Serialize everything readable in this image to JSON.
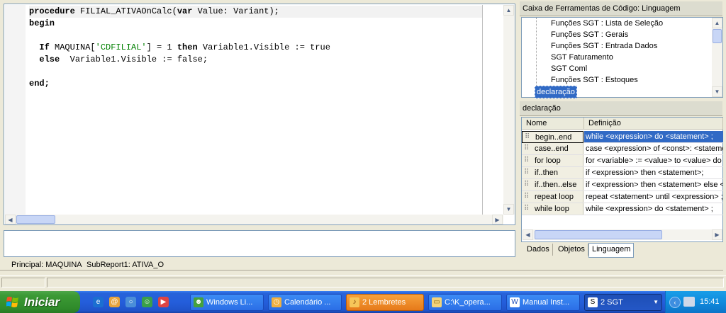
{
  "editor": {
    "lines": [
      {
        "tokens": [
          {
            "t": "procedure",
            "k": "kw"
          },
          {
            "t": " FILIAL_ATIVAOnCalc("
          },
          {
            "t": "var",
            "k": "kw"
          },
          {
            "t": " Value: Variant);"
          }
        ]
      },
      {
        "tokens": [
          {
            "t": "begin",
            "k": "kw"
          }
        ]
      },
      {
        "tokens": []
      },
      {
        "tokens": [
          {
            "t": "  "
          },
          {
            "t": "If",
            "k": "kw"
          },
          {
            "t": " MAQUINA["
          },
          {
            "t": "'CDFILIAL'",
            "k": "str"
          },
          {
            "t": "] = 1 "
          },
          {
            "t": "then",
            "k": "kw"
          },
          {
            "t": " Variable1.Visible := true"
          }
        ]
      },
      {
        "tokens": [
          {
            "t": "  "
          },
          {
            "t": "else",
            "k": "kw"
          },
          {
            "t": "  Variable1.Visible := false;"
          }
        ]
      },
      {
        "tokens": []
      },
      {
        "tokens": [
          {
            "t": "end;",
            "k": "kw"
          }
        ]
      }
    ]
  },
  "report_tabs": [
    "Principal: MAQUINA",
    "SubReport1: ATIVA_O"
  ],
  "toolbox": {
    "title": "Caixa de Ferramentas de Código: Linguagem",
    "tree_items": [
      "Funções SGT : Lista de Seleção",
      "Funções SGT : Gerais",
      "Funções SGT : Entrada Dados",
      "SGT Faturamento",
      "SGT Coml",
      "Funções SGT : Estoques"
    ],
    "selected_item": "declaração"
  },
  "declaration": {
    "title": "declaração",
    "headers": {
      "name": "Nome",
      "definition": "Definição"
    },
    "rows": [
      {
        "name": "begin..end",
        "definition": "while <expression> do <statement> ;"
      },
      {
        "name": "case..end",
        "definition": "case <expression> of <const>: <statement"
      },
      {
        "name": "for loop",
        "definition": "for <variable> := <value> to <value> do <"
      },
      {
        "name": "if..then",
        "definition": "if <expression> then <statement>;"
      },
      {
        "name": "if..then..else",
        "definition": "if <expression> then <statement> else <st"
      },
      {
        "name": "repeat loop",
        "definition": "repeat <statement> until <expression> ;"
      },
      {
        "name": "while loop",
        "definition": "while <expression> do <statement> ;"
      }
    ]
  },
  "panel_tabs": [
    "Dados",
    "Objetos",
    "Linguagem"
  ],
  "taskbar": {
    "start_label": "Iniciar",
    "buttons": [
      {
        "label": "Windows Li...",
        "icon": "people-icon"
      },
      {
        "label": "Calendário ...",
        "icon": "calendar-icon"
      },
      {
        "label": "2 Lembretes",
        "icon": "bell-icon"
      },
      {
        "label": "C:\\K_opera...",
        "icon": "folder-icon"
      },
      {
        "label": "Manual Inst...",
        "icon": "document-icon"
      },
      {
        "label": "2 SGT",
        "icon": "app-icon"
      }
    ],
    "clock": "15:41"
  },
  "colors": {
    "selection": "#316ac5",
    "string": "#008000",
    "taskbar": "#245edb",
    "start": "#3c9a35"
  }
}
